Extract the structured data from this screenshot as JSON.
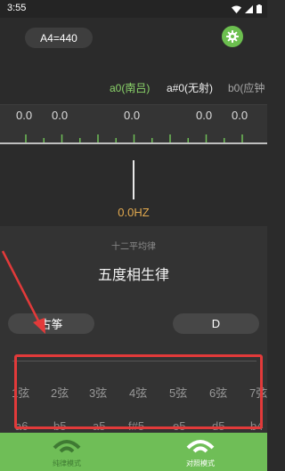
{
  "status_bar": {
    "time": "3:55"
  },
  "header": {
    "a4_label": "A4=440"
  },
  "note_strip": [
    {
      "label": "a0(南吕)",
      "color": "#8bd46a"
    },
    {
      "label": "a#0(无射)",
      "color": "#f0f0f0"
    },
    {
      "label": "b0(应钟",
      "color": "#a8a8a8"
    }
  ],
  "meter": {
    "readouts": [
      "0.0",
      "0.0",
      "0.0",
      "0.0",
      "0.0"
    ]
  },
  "tuner": {
    "frequency": "0.0HZ"
  },
  "temperament": {
    "secondary": "十二平均律",
    "primary": "五度相生律"
  },
  "instrument": {
    "name": "古筝",
    "key": "D"
  },
  "strings": {
    "labels": [
      "1弦",
      "2弦",
      "3弦",
      "4弦",
      "5弦",
      "6弦",
      "7弦"
    ],
    "notes": [
      "a6",
      "b5",
      "a5",
      "f#5",
      "e5",
      "d5",
      "b4"
    ]
  },
  "bottom_nav": {
    "tab1_label": "纯律模式",
    "tab2_label": "对照模式"
  },
  "colors": {
    "accent": "#6fbe57",
    "frequency": "#e2a94f",
    "highlight": "#e23a3a"
  }
}
